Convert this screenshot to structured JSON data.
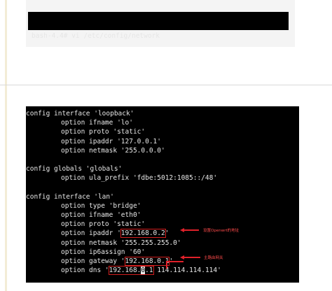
{
  "terminal_top": {
    "command": "bash-4.4# vi /etc/config/network"
  },
  "config": {
    "block1": {
      "header": "config interface 'loopback'",
      "options": [
        "option ifname 'lo'",
        "option proto 'static'",
        "option ipaddr '127.0.0.1'",
        "option netmask '255.0.0.0'"
      ]
    },
    "block2": {
      "header": "config globals 'globals'",
      "options": [
        "option ula_prefix 'fdbe:5012:1085::/48'"
      ]
    },
    "block3": {
      "header": "config interface 'lan'",
      "options": [
        "option type 'bridge'",
        "option ifname 'eth0'",
        "option proto 'static'"
      ],
      "ipaddr_key": "option ipaddr '",
      "ipaddr_value": "192.168.0.2",
      "ipaddr_tail": "'",
      "netmask": "option netmask '255.255.255.0'",
      "ip6assign": "option ip6assign '60'",
      "gateway_key": "option gateway '",
      "gateway_value": "192.168.0.1",
      "gateway_tail": "'",
      "dns_key": "option dns '",
      "dns_value_a": "192.168.",
      "dns_value_cursor": "0",
      "dns_value_b": ".1",
      "dns_tail": " 114.114.114.114'"
    }
  },
  "annotations": {
    "ipaddr_note": "设置Openwrt的地址",
    "gateway_note": "主路由网关",
    "color": "#e0212a"
  }
}
